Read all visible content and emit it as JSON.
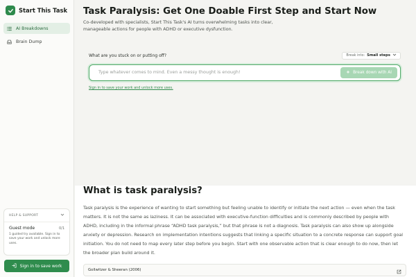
{
  "brand": {
    "name": "Start This Task",
    "logo_icon": "checkmark"
  },
  "sidebar": {
    "items": [
      {
        "label": "AI Breakdowns",
        "icon": "list-icon",
        "active": true
      },
      {
        "label": "Brain Dump",
        "icon": "inbox-icon",
        "active": false
      }
    ],
    "help": {
      "heading": "HELP & SUPPORT",
      "guest_title": "Guest mode",
      "guest_count": "0/1",
      "guest_desc": "1 guided try available. Sign in to save your work and unlock more uses."
    },
    "signin_label": "Sign in to save work"
  },
  "hero": {
    "title": "Task Paralysis: Get One Doable First Step and Start Now",
    "subtitle": "Co-developed with specialists, Start This Task's AI turns overwhelming tasks into clear, manageable actions for people with ADHD or executive dysfunction."
  },
  "task_input": {
    "prompt": "What are you stuck on or putting off?",
    "break_label": "Break into:",
    "break_value": "Small steps",
    "placeholder": "Type whatever comes to mind. Even a messy thought is enough!",
    "button_label": "Break down with AI",
    "save_link": "Sign in to save your work and unlock more uses."
  },
  "article": {
    "title": "What is task paralysis?",
    "body": "Task paralysis is the experience of wanting to start something but feeling unable to identify or initiate the next action — even when the task matters. It is not the same as laziness. It can be associated with executive-function difficulties and is commonly described by people with ADHD, including in the informal phrase “ADHD task paralysis,” but that phrase is not a diagnosis. Task paralysis can also show up alongside anxiety or depression. Research on implementation intentions suggests that linking a specific situation to a concrete response can support goal initiation. You do not need to map every later step before you begin. Start with one observable action that is clear enough to do now, then let the broader plan build around it.",
    "reference": "Gollwitzer & Sheeran (2006)"
  },
  "colors": {
    "accent": "#2f8c4d",
    "accent_light": "#a8d7b4",
    "active_bg": "#e3efe5"
  }
}
